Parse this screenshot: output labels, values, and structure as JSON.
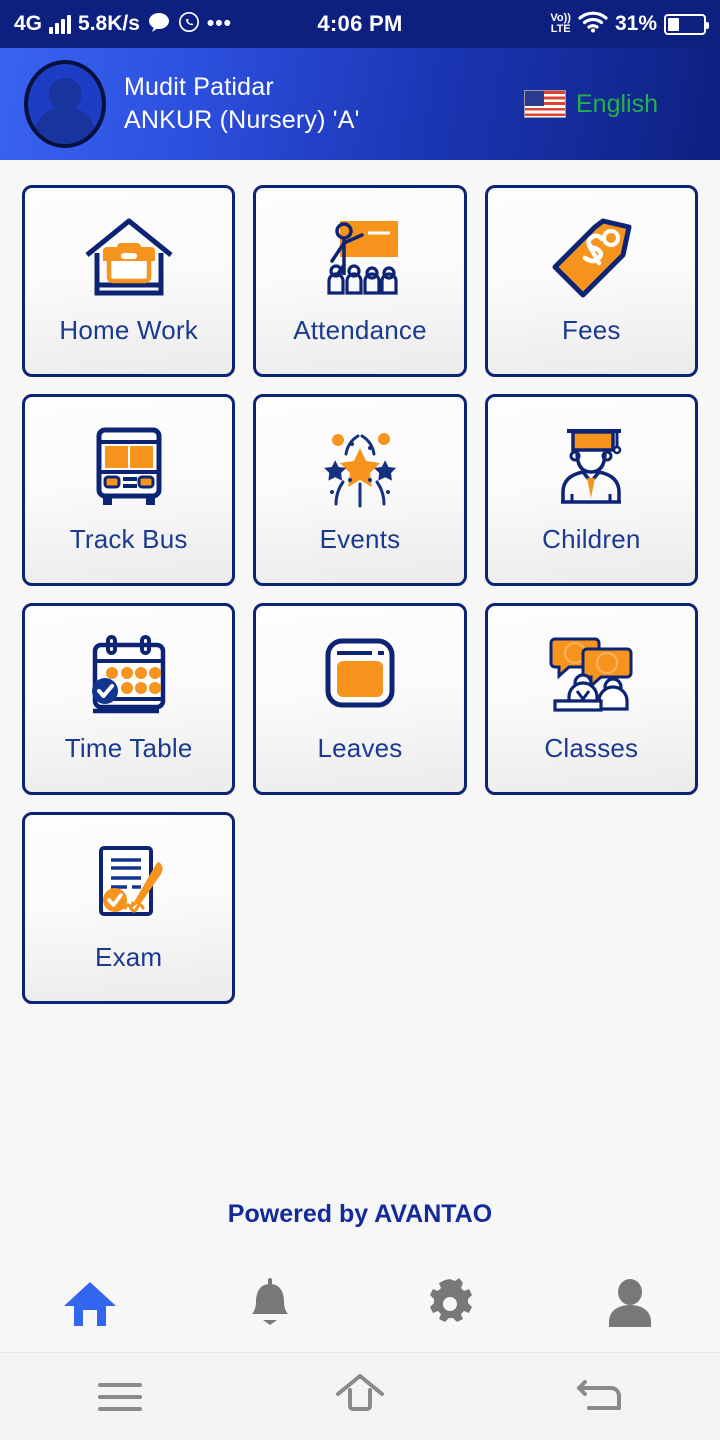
{
  "status_bar": {
    "network_type": "4G",
    "data_speed": "5.8K/s",
    "time": "4:06 PM",
    "volte_top": "Vo))",
    "volte_bottom": "LTE",
    "battery_percent": "31%",
    "battery_level": 31,
    "overflow_dots": "•••",
    "icons": [
      "signal-bars-icon",
      "message-bubble-icon",
      "whatsapp-icon",
      "volte-icon",
      "wifi-icon",
      "battery-icon"
    ],
    "background_color": "#0d2080",
    "text_color": "#ffffff"
  },
  "header": {
    "user_name": "Mudit Patidar",
    "user_class": "ANKUR (Nursery) 'A'",
    "language_label": "English",
    "language_flag": "us-flag-icon",
    "language_text_color": "#22b14c",
    "gradient_from": "#3a63f0",
    "gradient_to": "#0d2080"
  },
  "grid": {
    "tiles": [
      {
        "label": "Home Work",
        "icon": "house-briefcase-icon"
      },
      {
        "label": "Attendance",
        "icon": "teacher-board-students-icon"
      },
      {
        "label": "Fees",
        "icon": "price-tag-dollar-icon"
      },
      {
        "label": "Track Bus",
        "icon": "bus-front-icon"
      },
      {
        "label": "Events",
        "icon": "fireworks-star-icon"
      },
      {
        "label": "Children",
        "icon": "graduate-student-icon"
      },
      {
        "label": "Time Table",
        "icon": "calendar-check-icon"
      },
      {
        "label": "Leaves",
        "icon": "card-window-icon"
      },
      {
        "label": "Classes",
        "icon": "people-speech-bubbles-icon"
      },
      {
        "label": "Exam",
        "icon": "document-pen-check-icon"
      }
    ],
    "tile_border_color": "#0d2475",
    "tile_label_color": "#1b3a8f",
    "accent_orange": "#f7941e",
    "accent_navy": "#0d2475"
  },
  "footer": {
    "powered_by": "Powered by AVANTAO",
    "powered_by_color": "#142a9b",
    "nav_items": [
      {
        "name": "home",
        "icon": "home-icon",
        "active": true,
        "color": "#3366ee"
      },
      {
        "name": "notifications",
        "icon": "bell-icon",
        "active": false,
        "color": "#787878"
      },
      {
        "name": "settings",
        "icon": "gear-icon",
        "active": false,
        "color": "#787878"
      },
      {
        "name": "profile",
        "icon": "person-icon",
        "active": false,
        "color": "#787878"
      }
    ]
  },
  "android_nav": {
    "items": [
      {
        "name": "recents",
        "icon": "hamburger-menu-icon"
      },
      {
        "name": "home",
        "icon": "home-outline-icon"
      },
      {
        "name": "back",
        "icon": "back-arrow-icon"
      }
    ],
    "icon_color": "#8a8a8a"
  }
}
